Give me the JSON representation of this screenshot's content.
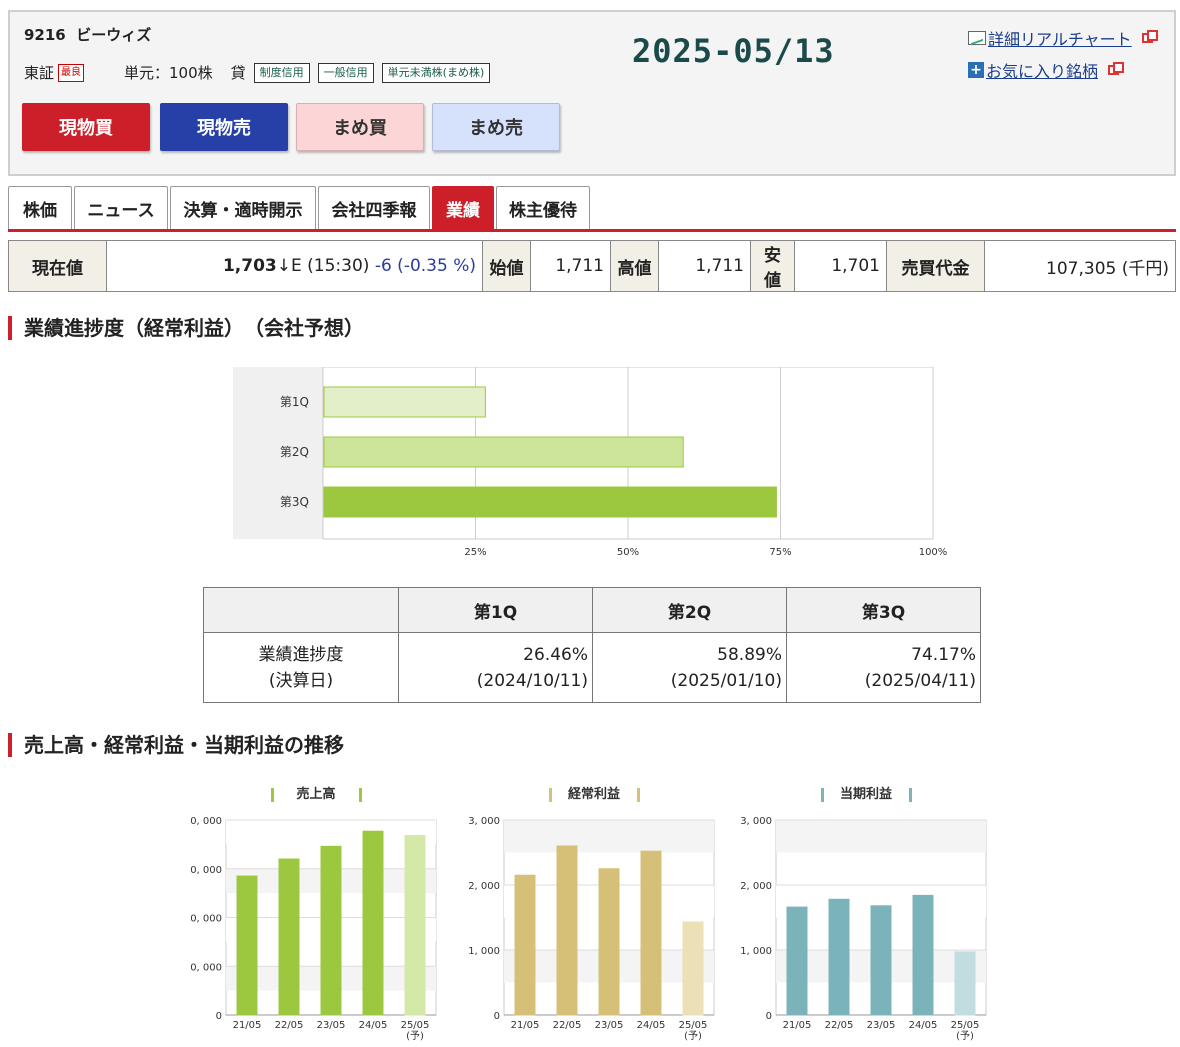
{
  "header": {
    "code": "9216",
    "name": "ビーウィズ",
    "exchange": "東証",
    "market": "最良",
    "unit_label": "単元：100株",
    "lend_label": "貸",
    "badges": [
      "制度信用",
      "一般信用",
      "単元未満株(まめ株)"
    ],
    "date": "2025-05/13",
    "links": [
      "詳細リアルチャート",
      "お気に入り銘柄"
    ],
    "buttons": {
      "buy": "現物買",
      "sell": "現物売",
      "mame_buy": "まめ買",
      "mame_sell": "まめ売"
    }
  },
  "tabs": [
    "株価",
    "ニュース",
    "決算・適時開示",
    "会社四季報",
    "業績",
    "株主優待"
  ],
  "active_tab": "業績",
  "quote": {
    "current_label": "現在値",
    "current_value": "1,703",
    "arrow": "↓",
    "flag": "E",
    "time": "(15:30)",
    "change": "-6 (-0.35 %)",
    "open_label": "始値",
    "open": "1,711",
    "high_label": "高値",
    "high": "1,711",
    "low_label": "安値",
    "low": "1,701",
    "turnover_label": "売買代金",
    "turnover": "107,305 (千円)"
  },
  "progress_section_title": "業績進捗度（経常利益）　（会社予想）",
  "chart_data": [
    {
      "type": "bar",
      "orientation": "horizontal",
      "categories": [
        "第1Q",
        "第2Q",
        "第3Q"
      ],
      "values": [
        26.46,
        58.89,
        74.17
      ],
      "colors": [
        "#e2efc8",
        "#cde59a",
        "#9cc83f"
      ],
      "xlim": [
        0,
        100
      ],
      "xticks": [
        "25%",
        "50%",
        "75%",
        "100%"
      ],
      "grid": true
    },
    {
      "type": "bar",
      "title": "売上高",
      "categories": [
        "21/05",
        "22/05",
        "23/05",
        "24/05",
        "25/05"
      ],
      "category_note": "(予)",
      "values": [
        28500,
        32000,
        34600,
        37700,
        36800
      ],
      "yticks": [
        "0",
        "0, 000",
        "0, 000",
        "0, 000",
        "0, 000"
      ],
      "ylim": [
        0,
        40000
      ],
      "color": "#9cc83f",
      "forecast_color": "#d4e8a8",
      "grid": true
    },
    {
      "type": "bar",
      "title": "経常利益",
      "categories": [
        "21/05",
        "22/05",
        "23/05",
        "24/05",
        "25/05"
      ],
      "category_note": "(予)",
      "values": [
        2150,
        2600,
        2250,
        2520,
        1430
      ],
      "yticks": [
        "0",
        "1, 000",
        "2, 000",
        "3, 000"
      ],
      "ylim": [
        0,
        3000
      ],
      "color": "#d6c078",
      "forecast_color": "#ece0b6",
      "grid": true
    },
    {
      "type": "bar",
      "title": "当期利益",
      "categories": [
        "21/05",
        "22/05",
        "23/05",
        "24/05",
        "25/05"
      ],
      "category_note": "(予)",
      "values": [
        1660,
        1780,
        1680,
        1840,
        970
      ],
      "yticks": [
        "0",
        "1, 000",
        "2, 000",
        "3, 000"
      ],
      "ylim": [
        0,
        3000
      ],
      "color": "#7bb3ba",
      "forecast_color": "#c2dde0",
      "grid": true
    }
  ],
  "progress_table": {
    "row_label_1": "業績進捗度",
    "row_label_2": "(決算日)",
    "cols": [
      {
        "q": "第1Q",
        "pct": "26.46%",
        "date": "(2024/10/11)"
      },
      {
        "q": "第2Q",
        "pct": "58.89%",
        "date": "(2025/01/10)"
      },
      {
        "q": "第3Q",
        "pct": "74.17%",
        "date": "(2025/04/11)"
      }
    ]
  },
  "trend_section_title": "売上高・経常利益・当期利益の推移"
}
